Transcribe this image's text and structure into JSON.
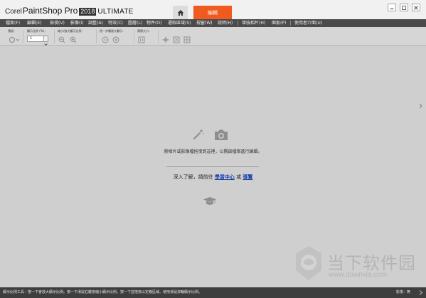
{
  "app": {
    "brand_corel": "Corel",
    "brand_name": "PaintShop Pro",
    "brand_version": "2018",
    "brand_edition": "ULTIMATE"
  },
  "tabs": {
    "edit_label": "編輯"
  },
  "menu": {
    "items": [
      "檔案(F)",
      "編輯(E)",
      "檢視(V)",
      "影像(I)",
      "調整(A)",
      "特效(C)",
      "圖層(L)",
      "物件(O)",
      "選取區域(S)",
      "視窗(W)",
      "說明(H)",
      "增強相片(H)",
      "面板(P)",
      "使用者介面(U)"
    ]
  },
  "toolbar": {
    "preset_label": "預設：",
    "zoom_label": "顯示比例 (%)：",
    "zoom_value": "1",
    "zoom_step_label": "縮小/放大顯示比例：",
    "zoom_more_label": "逐一步驟放大顯示：",
    "actual_size_label": "實際大小："
  },
  "canvas": {
    "hint": "將相片或影像檔拖曳到這裡，以開啟檔案進行編輯。",
    "learn_prefix": "深入了解，請前往",
    "learn_link1": "學習中心",
    "learn_or": "或",
    "learn_link2": "導覽"
  },
  "status": {
    "text": "顯示比例工具：按一下會放大顯示比例。按一下滑鼠右鍵會縮小顯示比例。按一下並拖曳以定義區域。使用滑鼠滾輪顯示比例。",
    "zoom_label": "影像：無"
  },
  "watermark": {
    "text": "当下软件园",
    "url": "www.downxia.com"
  },
  "colors": {
    "accent": "#f05a1e",
    "menubar": "#4b4b4b",
    "canvas": "#cfcfcf",
    "link": "#1a3fa8"
  }
}
